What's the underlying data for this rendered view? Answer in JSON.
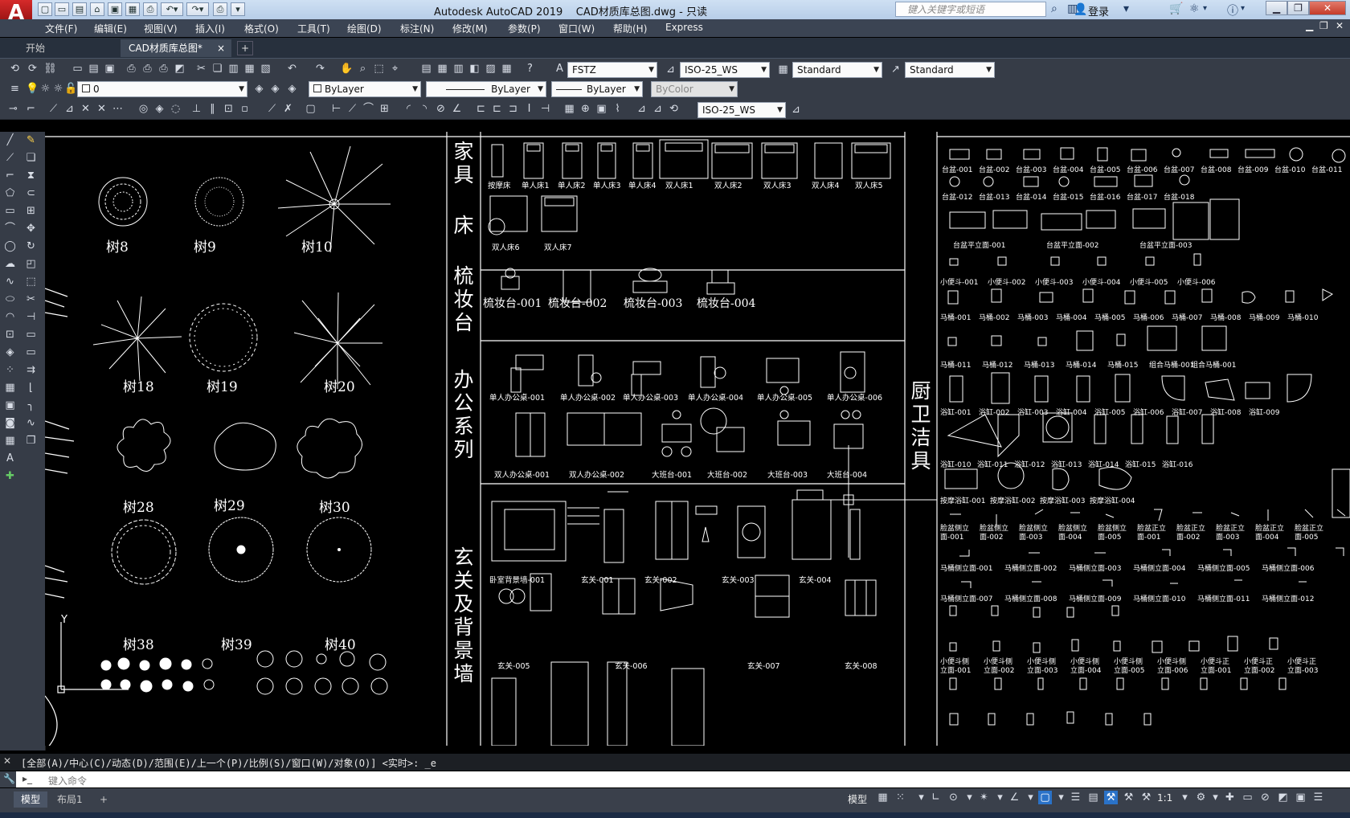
{
  "titlebar": {
    "app_title": "Autodesk AutoCAD 2019",
    "document_title": "CAD材质库总图.dwg - 只读",
    "search_placeholder": "键入关键字或短语",
    "login_label": "登录",
    "app_logo_letter": "A"
  },
  "menu": [
    "文件(F)",
    "编辑(E)",
    "视图(V)",
    "插入(I)",
    "格式(O)",
    "工具(T)",
    "绘图(D)",
    "标注(N)",
    "修改(M)",
    "参数(P)",
    "窗口(W)",
    "帮助(H)",
    "Express"
  ],
  "tabs": {
    "start": "开始",
    "document": "CAD材质库总图*",
    "close_glyph": "×",
    "new_glyph": "+"
  },
  "styles_toolbar": {
    "text_style": "FSTZ",
    "dim_style": "ISO-25_WS",
    "table_style": "Standard",
    "multileader_style": "Standard"
  },
  "layers_toolbar": {
    "layer_name": "0",
    "color": "ByLayer",
    "linetype": "ByLayer",
    "lineweight": "ByLayer",
    "plot_style": "ByColor"
  },
  "dim_toolbar": {
    "dim_style": "ISO-25_WS"
  },
  "drawing": {
    "trees": [
      "树8",
      "树9",
      "树10",
      "树18",
      "树19",
      "树20",
      "树28",
      "树29",
      "树30",
      "树38",
      "树39",
      "树40"
    ],
    "ucs_y_label": "Y",
    "furniture_heading_1": "家",
    "furniture_heading_2": "具",
    "bed_heading": "床",
    "dresser_heading": [
      "梳",
      "妆",
      "台"
    ],
    "office_heading": [
      "办",
      "公",
      "系",
      "列"
    ],
    "entry_heading": [
      "玄",
      "关",
      "及",
      "背",
      "景",
      "墙"
    ],
    "bath_heading": [
      "厨",
      "卫",
      "洁",
      "具"
    ],
    "beds": [
      "按摩床",
      "单人床1",
      "单人床2",
      "单人床3",
      "单人床4",
      "双人床1",
      "双人床2",
      "双人床3",
      "双人床4",
      "双人床5",
      "双人床6",
      "双人床7"
    ],
    "dressers": [
      "梳妆台-001",
      "梳妆台-002",
      "梳妆台-003",
      "梳妆台-004"
    ],
    "office_row1": [
      "单人办公桌-001",
      "单人办公桌-002",
      "单人办公桌-003",
      "单人办公桌-004",
      "单人办公桌-005",
      "单人办公桌-006"
    ],
    "office_row2": [
      "双人办公桌-001",
      "双人办公桌-002",
      "大班台-001",
      "大班台-002",
      "大班台-003",
      "大班台-004"
    ],
    "entry_row1": [
      "卧室背景墙-001",
      "玄关-001",
      "玄关-002",
      "玄关-003",
      "玄关-004"
    ],
    "entry_row2": [
      "玄关-005",
      "玄关-006",
      "玄关-007",
      "玄关-008"
    ],
    "basins_row1": [
      "台盆-001",
      "台盆-002",
      "台盆-003",
      "台盆-004",
      "台盆-005",
      "台盆-006",
      "台盆-007",
      "台盆-008",
      "台盆-009",
      "台盆-010",
      "台盆-011"
    ],
    "basins_row2": [
      "台盆-012",
      "台盆-013",
      "台盆-014",
      "台盆-015",
      "台盆-016",
      "台盆-017",
      "台盆-018"
    ],
    "basin_elev": [
      "台盆平立面-001",
      "台盆平立面-002",
      "台盆平立面-003"
    ],
    "urinals": [
      "小便斗-001",
      "小便斗-002",
      "小便斗-003",
      "小便斗-004",
      "小便斗-005",
      "小便斗-006"
    ],
    "toilets_row1": [
      "马桶-001",
      "马桶-002",
      "马桶-003",
      "马桶-004",
      "马桶-005",
      "马桶-006",
      "马桶-007",
      "马桶-008",
      "马桶-009",
      "马桶-010"
    ],
    "toilets_row2": [
      "马桶-011",
      "马桶-012",
      "马桶-013",
      "马桶-014",
      "马桶-015",
      "组合马桶-001",
      "组合马桶-001"
    ],
    "tubs_row1": [
      "浴缸-001",
      "浴缸-002",
      "浴缸-003",
      "浴缸-004",
      "浴缸-005",
      "浴缸-006",
      "浴缸-007",
      "浴缸-008",
      "浴缸-009"
    ],
    "tubs_row2": [
      "浴缸-010",
      "浴缸-011",
      "浴缸-012",
      "浴缸-013",
      "浴缸-014",
      "浴缸-015",
      "浴缸-016"
    ],
    "massage_tubs": [
      "按摩浴缸-001",
      "按摩浴缸-002",
      "按摩浴缸-003",
      "按摩浴缸-004"
    ],
    "basin_side_row": [
      "脸盆侧立",
      "脸盆侧立",
      "脸盆侧立",
      "脸盆侧立",
      "脸盆侧立",
      "脸盆正立",
      "脸盆正立",
      "脸盆正立",
      "脸盆正立",
      "脸盆正立"
    ],
    "basin_side_row_sub": [
      "面-001",
      "面-002",
      "面-003",
      "面-004",
      "面-005",
      "面-001",
      "面-002",
      "面-003",
      "面-004",
      "面-005"
    ],
    "toilet_side_row1": [
      "马桶侧立面-001",
      "马桶侧立面-002",
      "马桶侧立面-003",
      "马桶侧立面-004",
      "马桶侧立面-005",
      "马桶侧立面-006"
    ],
    "toilet_side_row2": [
      "马桶侧立面-007",
      "马桶侧立面-008",
      "马桶侧立面-009",
      "马桶侧立面-010",
      "马桶侧立面-011",
      "马桶侧立面-012"
    ],
    "urinal_side_row": [
      "小便斗侧",
      "小便斗侧",
      "小便斗侧",
      "小便斗侧",
      "小便斗侧",
      "小便斗侧",
      "小便斗正",
      "小便斗正",
      "小便斗正"
    ],
    "urinal_side_row_sub": [
      "立面-001",
      "立面-002",
      "立面-003",
      "立面-004",
      "立面-005",
      "立面-006",
      "立面-001",
      "立面-002",
      "立面-003"
    ]
  },
  "command": {
    "history": "[全部(A)/中心(C)/动态(D)/范围(E)/上一个(P)/比例(S)/窗口(W)/对象(O)] <实时>: _e",
    "placeholder": "键入命令"
  },
  "status": {
    "model_tab": "模型",
    "layout_tab": "布局1",
    "add_tab": "+",
    "model_button": "模型",
    "scale": "1:1"
  },
  "colors": {
    "accent": "#c62828",
    "toolbar_bg": "#363c47",
    "canvas_bg": "#000000"
  }
}
